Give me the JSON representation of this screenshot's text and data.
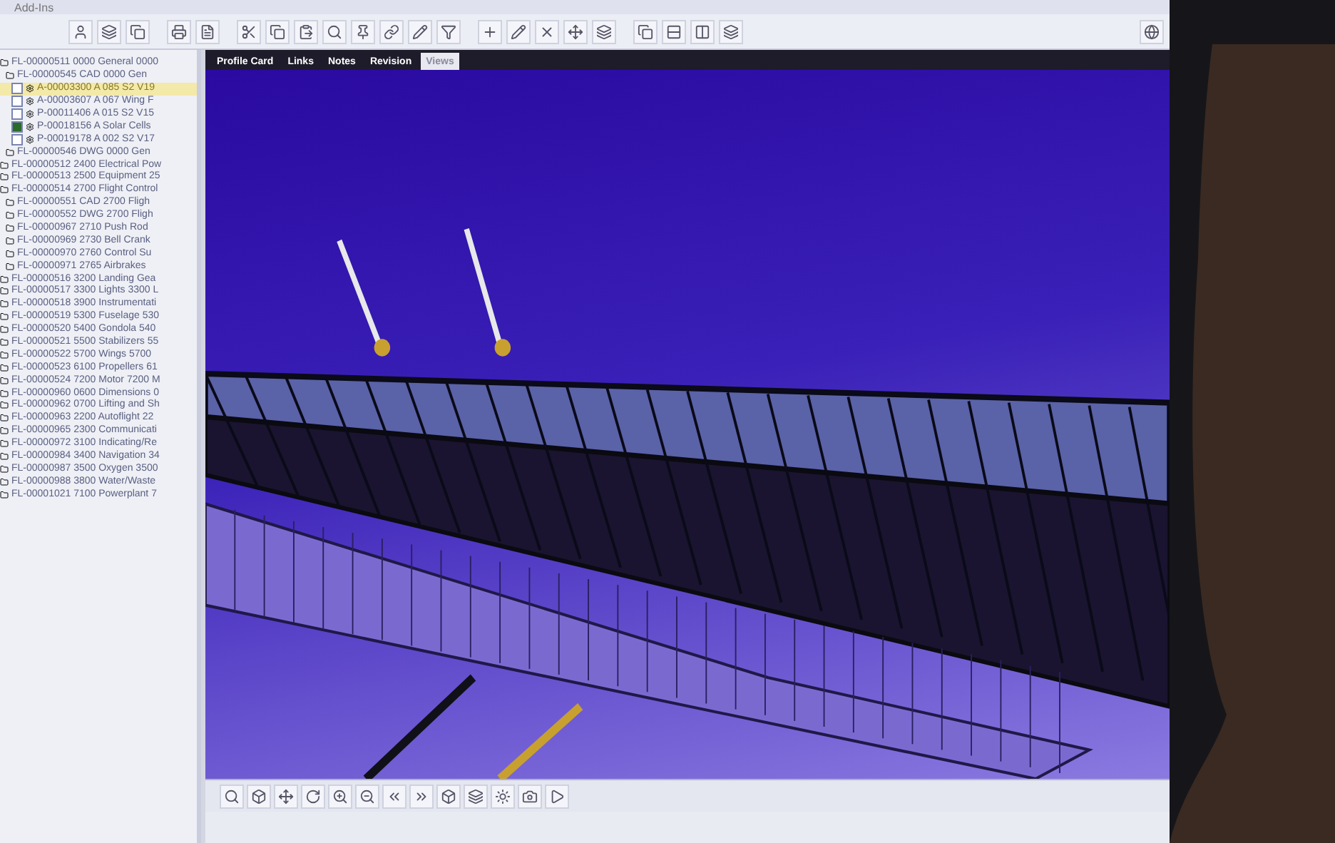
{
  "window": {
    "title": "Add-Ins"
  },
  "tabs": [
    {
      "label": "Profile Card",
      "selected": false
    },
    {
      "label": "Links",
      "selected": false
    },
    {
      "label": "Notes",
      "selected": false
    },
    {
      "label": "Revision",
      "selected": false
    },
    {
      "label": "Views",
      "selected": true
    }
  ],
  "tree": {
    "items": [
      {
        "kind": "folder",
        "label": "FL-00000511  0000 General 0000",
        "selected": false,
        "children": [
          {
            "kind": "folder",
            "label": "FL-00000545  CAD 0000 Gen",
            "selected": false,
            "children": [
              {
                "kind": "part",
                "label": "A-00003300  A 085 S2 V19",
                "selected": true,
                "checked": false
              },
              {
                "kind": "part",
                "label": "A-00003607  A 067 Wing F",
                "selected": false,
                "checked": false
              },
              {
                "kind": "part",
                "label": "P-00011406  A 015 S2 V15",
                "selected": false,
                "checked": false
              },
              {
                "kind": "part",
                "label": "P-00018156  A Solar Cells",
                "selected": false,
                "checked": true
              },
              {
                "kind": "part",
                "label": "P-00019178  A 002 S2 V17",
                "selected": false,
                "checked": false
              }
            ]
          },
          {
            "kind": "folder",
            "label": "FL-00000546  DWG 0000 Gen",
            "selected": false
          }
        ]
      },
      {
        "kind": "folder",
        "label": "FL-00000512  2400 Electrical Pow",
        "selected": false
      },
      {
        "kind": "folder",
        "label": "FL-00000513  2500 Equipment 25",
        "selected": false
      },
      {
        "kind": "folder",
        "label": "FL-00000514  2700 Flight Control",
        "selected": false,
        "children": [
          {
            "kind": "folder",
            "label": "FL-00000551  CAD 2700 Fligh",
            "selected": false
          },
          {
            "kind": "folder",
            "label": "FL-00000552  DWG 2700 Fligh",
            "selected": false
          },
          {
            "kind": "folder",
            "label": "FL-00000967  2710 Push Rod",
            "selected": false
          },
          {
            "kind": "folder",
            "label": "FL-00000969  2730 Bell Crank",
            "selected": false
          },
          {
            "kind": "folder",
            "label": "FL-00000970  2760 Control Su",
            "selected": false
          },
          {
            "kind": "folder",
            "label": "FL-00000971  2765 Airbrakes",
            "selected": false
          }
        ]
      },
      {
        "kind": "folder",
        "label": "FL-00000516  3200 Landing Gea",
        "selected": false
      },
      {
        "kind": "folder",
        "label": "FL-00000517  3300 Lights 3300 L",
        "selected": false
      },
      {
        "kind": "folder",
        "label": "FL-00000518  3900 Instrumentati",
        "selected": false
      },
      {
        "kind": "folder",
        "label": "FL-00000519  5300 Fuselage 530",
        "selected": false
      },
      {
        "kind": "folder",
        "label": "FL-00000520  5400 Gondola 540",
        "selected": false
      },
      {
        "kind": "folder",
        "label": "FL-00000521  5500 Stabilizers 55",
        "selected": false
      },
      {
        "kind": "folder",
        "label": "FL-00000522  5700 Wings 5700",
        "selected": false
      },
      {
        "kind": "folder",
        "label": "FL-00000523  6100 Propellers 61",
        "selected": false
      },
      {
        "kind": "folder",
        "label": "FL-00000524  7200 Motor 7200 M",
        "selected": false
      },
      {
        "kind": "folder",
        "label": "FL-00000960  0600 Dimensions 0",
        "selected": false
      },
      {
        "kind": "folder",
        "label": "FL-00000962  0700 Lifting and Sh",
        "selected": false
      },
      {
        "kind": "folder",
        "label": "FL-00000963  2200 Autoflight 22",
        "selected": false
      },
      {
        "kind": "folder",
        "label": "FL-00000965  2300 Communicati",
        "selected": false
      },
      {
        "kind": "folder",
        "label": "FL-00000972  3100 Indicating/Re",
        "selected": false
      },
      {
        "kind": "folder",
        "label": "FL-00000984  3400 Navigation 34",
        "selected": false
      },
      {
        "kind": "folder",
        "label": "FL-00000987  3500 Oxygen 3500",
        "selected": false
      },
      {
        "kind": "folder",
        "label": "FL-00000988  3800 Water/Waste",
        "selected": false
      },
      {
        "kind": "folder",
        "label": "FL-00001021  7100 Powerplant 7",
        "selected": false
      }
    ]
  }
}
